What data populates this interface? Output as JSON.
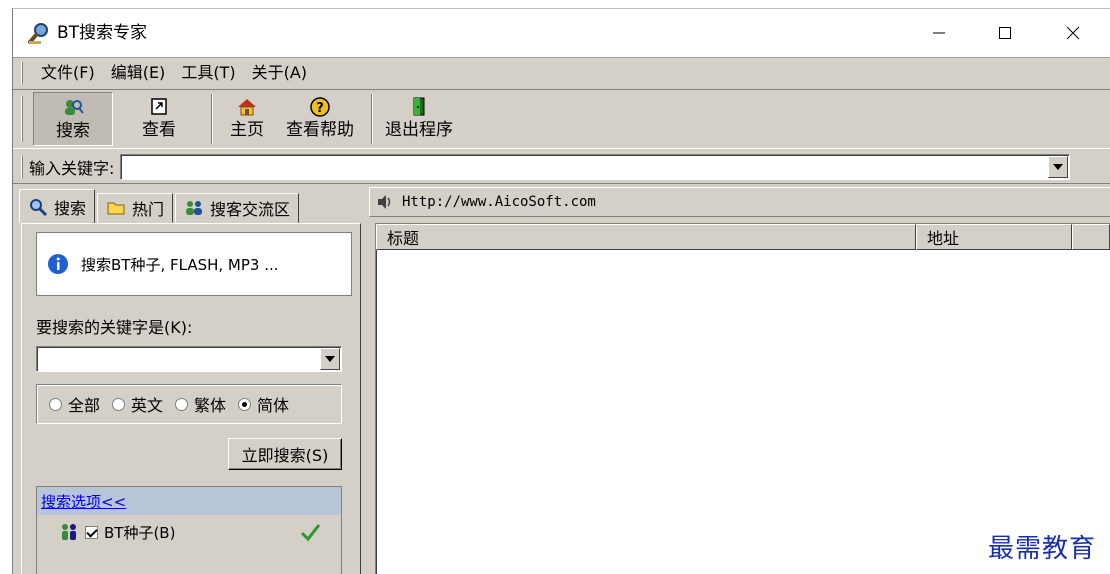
{
  "window": {
    "title": "BT搜索专家"
  },
  "menu": [
    {
      "label": "文件(F)"
    },
    {
      "label": "编辑(E)"
    },
    {
      "label": "工具(T)"
    },
    {
      "label": "关于(A)"
    }
  ],
  "toolbar": {
    "search": "搜索",
    "view": "查看",
    "home": "主页",
    "help": "查看帮助",
    "exit": "退出程序"
  },
  "keyword_bar": {
    "label": "输入关键字:",
    "value": ""
  },
  "tabs": [
    {
      "label": "搜索",
      "active": true
    },
    {
      "label": "热门",
      "active": false
    },
    {
      "label": "搜客交流区",
      "active": false
    }
  ],
  "left": {
    "info": "搜索BT种子, FLASH, MP3 ...",
    "keyword_label": "要搜索的关键字是(K):",
    "keyword_value": "",
    "radios": [
      {
        "label": "全部",
        "checked": false
      },
      {
        "label": "英文",
        "checked": false
      },
      {
        "label": "繁体",
        "checked": false
      },
      {
        "label": "简体",
        "checked": true
      }
    ],
    "search_button": "立即搜索(S)",
    "options_header": "搜索选项<<",
    "options": [
      {
        "label": "BT种子(B)",
        "checked": true
      }
    ]
  },
  "right": {
    "url": "Http://www.AicoSoft.com",
    "columns": {
      "title": "标题",
      "address": "地址"
    }
  },
  "watermark": "最需教育"
}
